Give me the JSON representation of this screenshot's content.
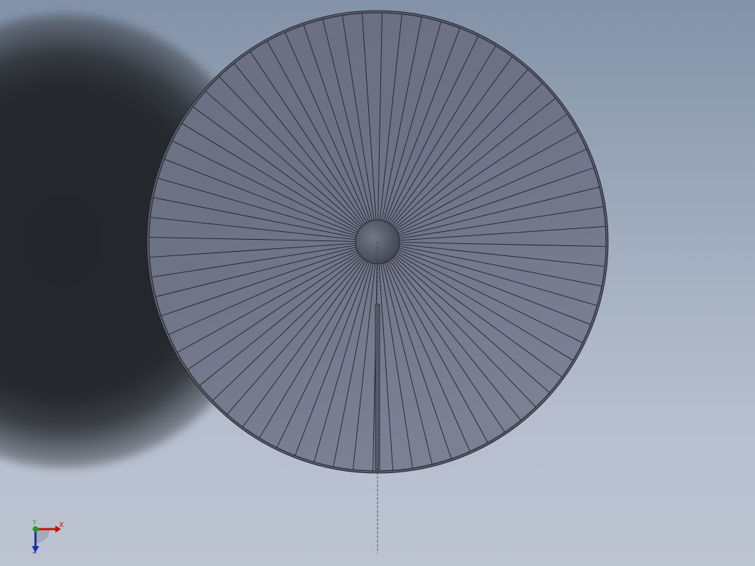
{
  "viewport": {
    "title": "",
    "background_top": "#8392a8",
    "background_bottom": "#bcc3d1"
  },
  "model": {
    "shape": "circular-disc",
    "radial_segments": 72,
    "face_color": "#6f7486",
    "edge_color": "#1e2028",
    "hub_color": "#4e5260"
  },
  "triad": {
    "x_label": "X",
    "y_label": "Y",
    "z_label": "Z",
    "x_color": "#d01010",
    "y_color": "#18a018",
    "z_color": "#2030c0"
  }
}
